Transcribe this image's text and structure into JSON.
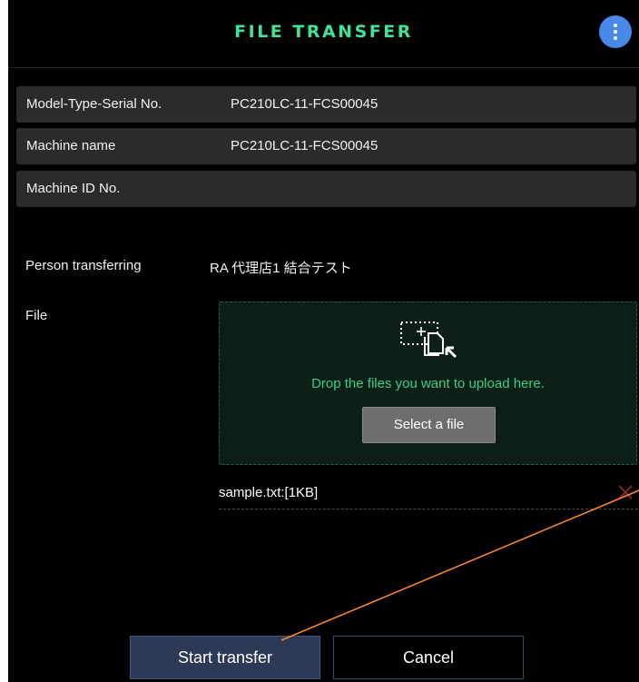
{
  "header": {
    "title": "FILE TRANSFER",
    "menu_icon": "kebab-menu-icon",
    "accent_color": "#3fe39a",
    "menu_color": "#4a88ea"
  },
  "machine_info": [
    {
      "label": "Model-Type-Serial No.",
      "value": "PC210LC-11-FCS00045"
    },
    {
      "label": "Machine name",
      "value": "PC210LC-11-FCS00045"
    },
    {
      "label": "Machine ID No.",
      "value": ""
    }
  ],
  "transfer": {
    "person_label": "Person transferring",
    "person_value": "RA 代理店1 結合テスト",
    "file_label": "File"
  },
  "dropzone": {
    "icon": "file-drop-icon",
    "text": "Drop the files you want to upload here.",
    "select_button": "Select a file"
  },
  "files": [
    {
      "name": "sample.txt:[1KB]",
      "remove_icon": "remove-x-icon"
    }
  ],
  "actions": {
    "start": "Start transfer",
    "cancel": "Cancel",
    "primary_color": "#2c3a55"
  }
}
